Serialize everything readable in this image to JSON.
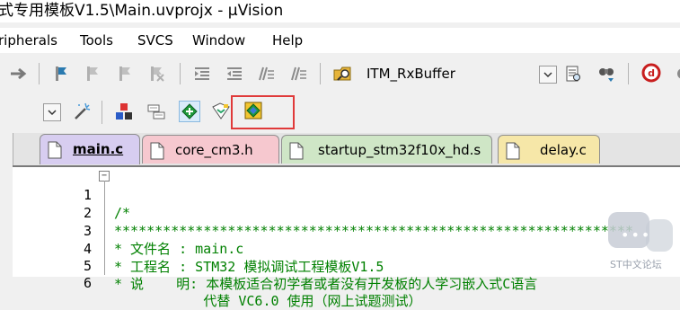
{
  "window": {
    "title": "式专用模板V1.5\\Main.uvprojx - µVision"
  },
  "menu": {
    "items": [
      "ripherals",
      "Tools",
      "SVCS",
      "Window",
      "Help"
    ]
  },
  "toolbar": {
    "target_combo": "ITM_RxBuffer"
  },
  "tabs": [
    {
      "label": "main.c",
      "active": true,
      "color": "#d7cdf0"
    },
    {
      "label": "core_cm3.h",
      "active": false,
      "color": "#f6c8cf"
    },
    {
      "label": "startup_stm32f10x_hd.s",
      "active": false,
      "color": "#cfe6c6"
    },
    {
      "label": "delay.c",
      "active": false,
      "color": "#f6e7a8"
    }
  ],
  "editor": {
    "lines": [
      {
        "num": "1",
        "text": "/*"
      },
      {
        "num": "2",
        "text": "****************************************************************"
      },
      {
        "num": "3",
        "text": "* 文件名 : main.c"
      },
      {
        "num": "4",
        "text": "* 工程名 : STM32 模拟调试工程模板V1.5"
      },
      {
        "num": "5",
        "text": "* 说    明: 本模板适合初学者或者没有开发板的人学习嵌入式C语言"
      },
      {
        "num": "6",
        "text": "           代替 VC6.0 使用（网上试题测试）"
      }
    ]
  },
  "watermark": {
    "text": "ST中文论坛"
  },
  "colors": {
    "comment": "#008000",
    "highlight_box": "#e03a3a"
  }
}
